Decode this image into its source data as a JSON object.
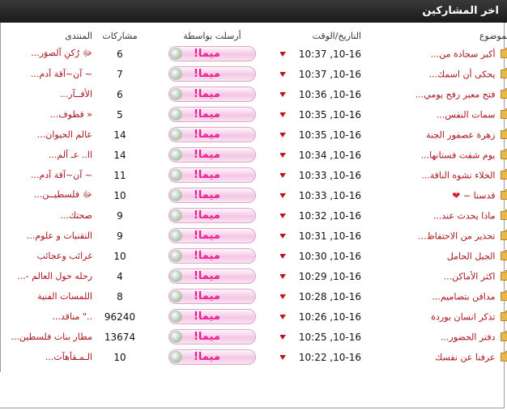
{
  "header": {
    "title": "اخر المشاركين"
  },
  "columns": {
    "topic": "الموضوع",
    "date": "التاريخ/الوقت",
    "by": "أرسلت بواسطة",
    "posts": "مشاركات",
    "forum": "المنتدى"
  },
  "icons": {
    "folder": "folder-icon",
    "arrow": "red-down-arrow-icon",
    "heart": "heart-icon",
    "badge_ball": "avatar-ball-icon"
  },
  "colors": {
    "title_bar": "#1f1f1f",
    "link": "#a8141b",
    "username": "#ee1a94",
    "arrow": "#c0141b"
  },
  "rows": [
    {
      "topic": "أكبر سجادة من...",
      "date": "10-16, 10:37",
      "user": "ميما!",
      "posts": "6",
      "forum": "ﷻ رُكنِ آلصوَر..."
    },
    {
      "topic": "يحكى أن اسمك...",
      "date": "10-16, 10:37",
      "user": "ميما!",
      "posts": "7",
      "forum": "~ آن~آقة آدم..."
    },
    {
      "topic": "فتح معبر رفح يومي...",
      "date": "10-16, 10:36",
      "user": "ميما!",
      "posts": "6",
      "forum": "الأفــآر..."
    },
    {
      "topic": "سمات النفس...",
      "date": "10-16, 10:35",
      "user": "ميما!",
      "posts": "5",
      "forum": "« قطوف..."
    },
    {
      "topic": "زهرة عصفور الجنة",
      "date": "10-16, 10:35",
      "user": "ميما!",
      "posts": "14",
      "forum": "عالم الحيوان..."
    },
    {
      "topic": "يوم شفت فستانها...",
      "date": "10-16, 10:34",
      "user": "ميما!",
      "posts": "14",
      "forum": "اا.. عـ آلم..."
    },
    {
      "topic": "الخلاء نشوه الناقة...",
      "date": "10-16, 10:33",
      "user": "ميما!",
      "posts": "11",
      "forum": "~ آن~آقة آدم..."
    },
    {
      "topic": "قدسنا ~",
      "heart": "❤",
      "date": "10-16, 10:33",
      "user": "ميما!",
      "posts": "10",
      "forum": "ﷻ فلسطيــن..."
    },
    {
      "topic": "ماذا يحدث عند...",
      "date": "10-16, 10:32",
      "user": "ميما!",
      "posts": "9",
      "forum": "صحتك..."
    },
    {
      "topic": "تحذير من الاحتفاظ...",
      "date": "10-16, 10:31",
      "user": "ميما!",
      "posts": "9",
      "forum": "التقنيات و علوم..."
    },
    {
      "topic": "الجبل الحامل",
      "date": "10-16, 10:30",
      "user": "ميما!",
      "posts": "10",
      "forum": "غرائب وعجائب"
    },
    {
      "topic": "اكثر الأماكن...",
      "date": "10-16, 10:29",
      "user": "ميما!",
      "posts": "4",
      "forum": "رحله حول العالم -..."
    },
    {
      "topic": "مداقن بتصاميم...",
      "date": "10-16, 10:28",
      "user": "ميما!",
      "posts": "8",
      "forum": "اللمسات الفنية"
    },
    {
      "topic": "تذكر انسان بوردة",
      "date": "10-16, 10:26",
      "user": "ميما!",
      "posts": "96240",
      "forum": "..\" مناقد..."
    },
    {
      "topic": "دفتر الحضور...",
      "date": "10-16, 10:25",
      "user": "ميما!",
      "posts": "13674",
      "forum": "مطار بنات فلسطين..."
    },
    {
      "topic": "عرفنا عن نفسك",
      "date": "10-16, 10:22",
      "user": "ميما!",
      "posts": "10",
      "forum": "الـمـقآهآث..."
    }
  ]
}
